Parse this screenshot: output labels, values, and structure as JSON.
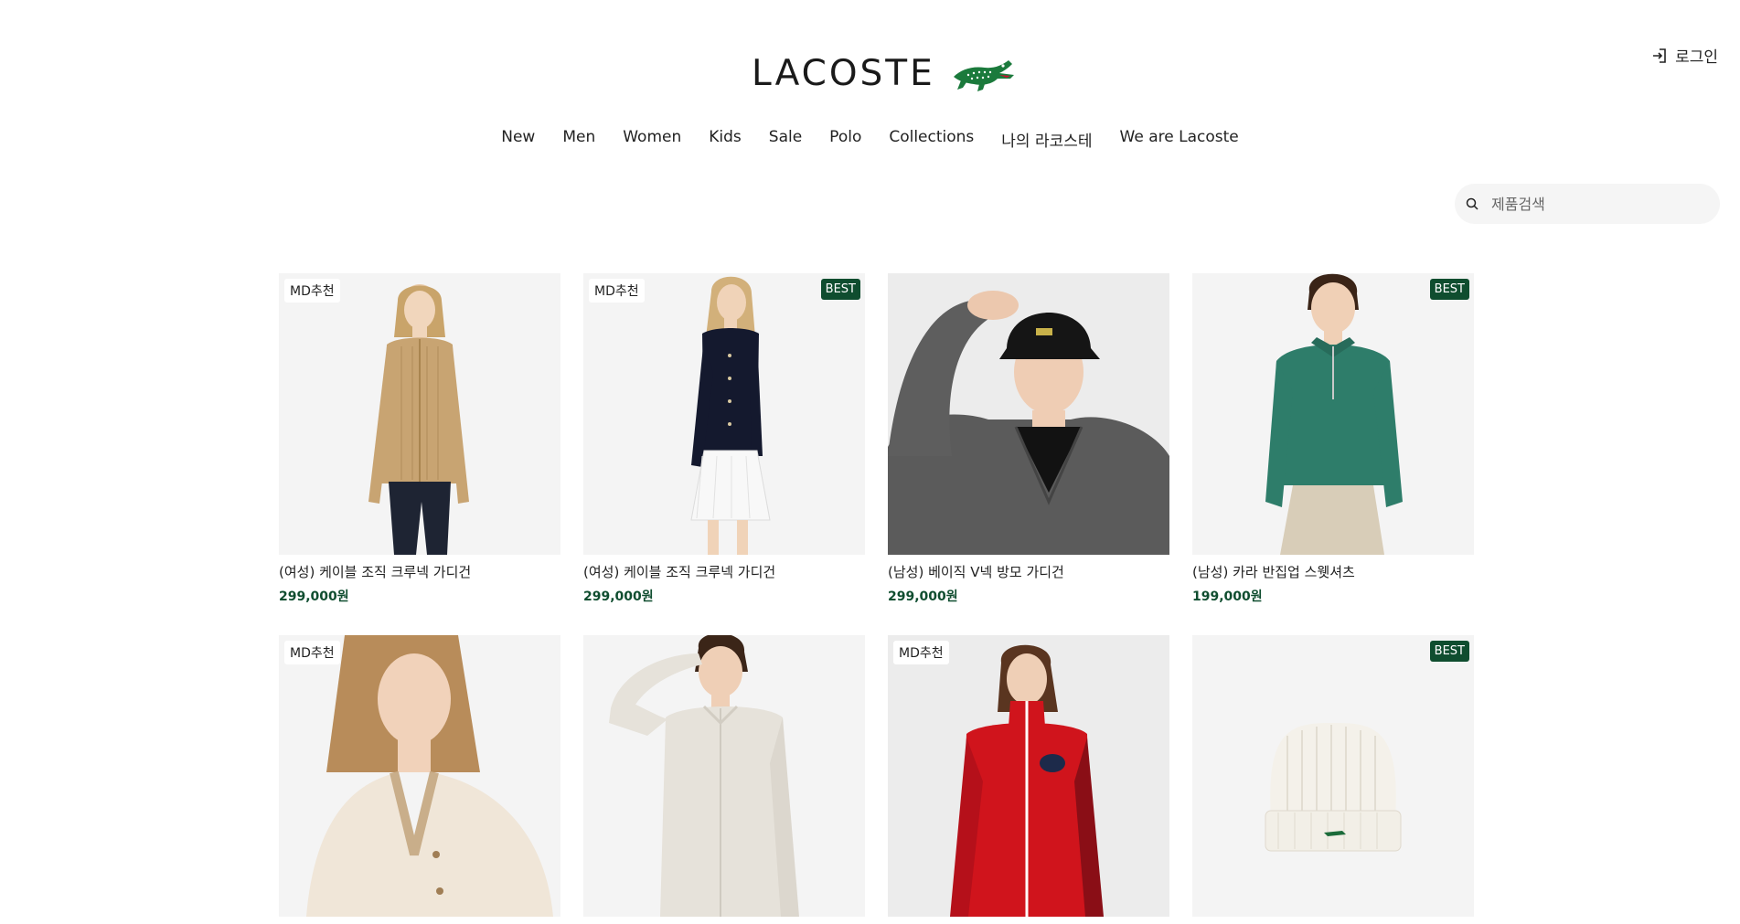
{
  "header": {
    "logo_text": "LACOSTE",
    "login_label": "로그인"
  },
  "nav": [
    "New",
    "Men",
    "Women",
    "Kids",
    "Sale",
    "Polo",
    "Collections",
    "나의 라코스테",
    "We are Lacoste"
  ],
  "search": {
    "placeholder": "제품검색"
  },
  "colors": {
    "brand_green": "#0f4d2f",
    "best_badge": "#0f4d2f"
  },
  "products": [
    {
      "md": "MD추천",
      "best": "",
      "name": "(여성) 케이블 조직 크루넥 가디건",
      "price": "299,000원"
    },
    {
      "md": "MD추천",
      "best": "BEST",
      "name": "(여성) 케이블 조직 크루넥 가디건",
      "price": "299,000원"
    },
    {
      "md": "",
      "best": "",
      "name": "(남성) 베이직 V넥 방모 가디건",
      "price": "299,000원"
    },
    {
      "md": "",
      "best": "BEST",
      "name": "(남성) 카라 반집업 스웻셔츠",
      "price": "199,000원"
    },
    {
      "md": "MD추천",
      "best": "",
      "name": "",
      "price": ""
    },
    {
      "md": "",
      "best": "",
      "name": "",
      "price": ""
    },
    {
      "md": "MD추천",
      "best": "",
      "name": "",
      "price": ""
    },
    {
      "md": "",
      "best": "BEST",
      "name": "",
      "price": ""
    }
  ]
}
